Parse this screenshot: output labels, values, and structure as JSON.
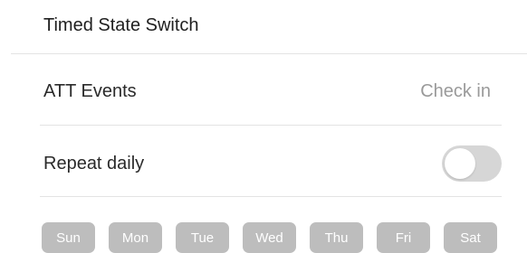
{
  "header": {
    "title": "Timed State Switch"
  },
  "att_events": {
    "label": "ATT Events",
    "value": "Check in"
  },
  "repeat_daily": {
    "label": "Repeat daily",
    "enabled": false
  },
  "days": [
    {
      "label": "Sun",
      "selected": false
    },
    {
      "label": "Mon",
      "selected": false
    },
    {
      "label": "Tue",
      "selected": false
    },
    {
      "label": "Wed",
      "selected": false
    },
    {
      "label": "Thu",
      "selected": false
    },
    {
      "label": "Fri",
      "selected": false
    },
    {
      "label": "Sat",
      "selected": false
    }
  ],
  "colors": {
    "divider": "#e3e3e3",
    "toggle_off": "#d6d6d6",
    "day_chip": "#bdbdbd",
    "secondary_text": "#9a9a9a"
  }
}
